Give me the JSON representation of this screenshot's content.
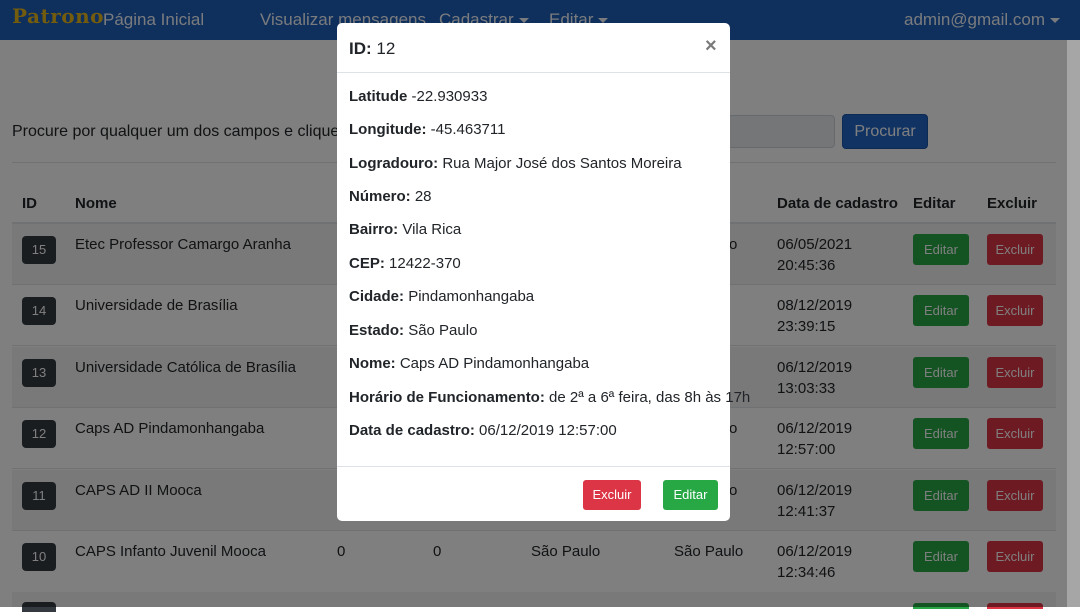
{
  "navbar": {
    "brand": "Patrono",
    "links": {
      "home": "Página Inicial",
      "messages": "Visualizar mensagens",
      "register": "Cadastrar",
      "edit": "Editar"
    },
    "user": "admin@gmail.com"
  },
  "search": {
    "label": "Procure por qualquer um dos campos e clique no bot",
    "input_value": "",
    "button": "Procurar"
  },
  "table": {
    "headers": {
      "id": "ID",
      "nome": "Nome",
      "data": "Data de cadastro",
      "editar": "Editar",
      "excluir": "Excluir"
    },
    "rows": [
      {
        "id": "15",
        "nome": "Etec Professor Camargo Aranha",
        "c1": "",
        "c2": "",
        "cidade": "",
        "estado": "",
        "partial": "o",
        "date": "06/05/2021",
        "time": "20:45:36",
        "edit": "Editar",
        "del": "Excluir"
      },
      {
        "id": "14",
        "nome": "Universidade de Brasília",
        "c1": "",
        "c2": "",
        "cidade": "",
        "estado": "",
        "partial": "",
        "date": "08/12/2019",
        "time": "23:39:15",
        "edit": "Editar",
        "del": "Excluir"
      },
      {
        "id": "13",
        "nome": "Universidade Católica de Brasília",
        "c1": "",
        "c2": "",
        "cidade": "",
        "estado": "",
        "partial": "",
        "date": "06/12/2019",
        "time": "13:03:33",
        "edit": "Editar",
        "del": "Excluir"
      },
      {
        "id": "12",
        "nome": "Caps AD Pindamonhangaba",
        "c1": "",
        "c2": "",
        "cidade": "",
        "estado": "",
        "partial": "o",
        "date": "06/12/2019",
        "time": "12:57:00",
        "edit": "Editar",
        "del": "Excluir"
      },
      {
        "id": "11",
        "nome": "CAPS AD II Mooca",
        "c1": "",
        "c2": "",
        "cidade": "",
        "estado": "",
        "partial": "o",
        "date": "06/12/2019",
        "time": "12:41:37",
        "edit": "Editar",
        "del": "Excluir"
      },
      {
        "id": "10",
        "nome": "CAPS Infanto Juvenil Mooca",
        "c1": "0",
        "c2": "0",
        "cidade": "São Paulo",
        "estado": "São Paulo",
        "partial": "",
        "date": "06/12/2019",
        "time": "12:34:46",
        "edit": "Editar",
        "del": "Excluir"
      }
    ]
  },
  "modal": {
    "title_label": "ID:",
    "title_value": "12",
    "close": "×",
    "fields": [
      {
        "label": "Latitude",
        "value": "-22.930933"
      },
      {
        "label": "Longitude:",
        "value": "-45.463711"
      },
      {
        "label": "Logradouro:",
        "value": "Rua Major José dos Santos Moreira"
      },
      {
        "label": "Número:",
        "value": "28"
      },
      {
        "label": "Bairro:",
        "value": "Vila Rica"
      },
      {
        "label": "CEP:",
        "value": "12422-370"
      },
      {
        "label": "Cidade:",
        "value": "Pindamonhangaba"
      },
      {
        "label": "Estado:",
        "value": "São Paulo"
      },
      {
        "label": "Nome:",
        "value": "Caps AD Pindamonhangaba"
      },
      {
        "label": "Horário de Funcionamento:",
        "value": "de 2ª a 6ª feira, das 8h às 17h"
      },
      {
        "label": "Data de cadastro:",
        "value": "06/12/2019 12:57:00"
      }
    ],
    "delete_button": "Excluir",
    "edit_button": "Editar"
  },
  "colors": {
    "navbar": "#1f5fb8",
    "primary": "#2366c8",
    "success": "#28a745",
    "danger": "#dc3545",
    "badge": "#343a40"
  }
}
